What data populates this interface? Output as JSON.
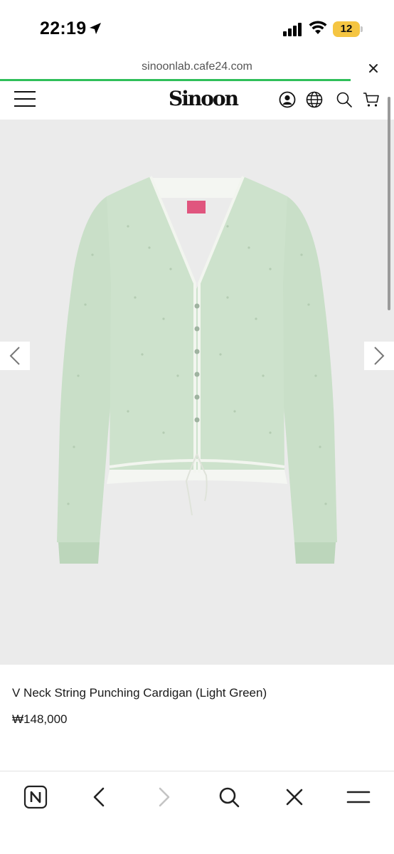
{
  "status_bar": {
    "time": "22:19",
    "battery": "12",
    "location_icon": "location-arrow-icon",
    "signal_icon": "cellular-signal-icon",
    "wifi_icon": "wifi-icon"
  },
  "browser": {
    "url": "sinoonlab.cafe24.com",
    "close_icon": "close-icon",
    "load_progress": 0.89
  },
  "site_header": {
    "logo": "Sinoon",
    "menu_icon": "hamburger-menu-icon",
    "account_icon": "user-account-icon",
    "language_icon": "globe-icon",
    "search_icon": "search-icon",
    "cart_icon": "shopping-cart-icon"
  },
  "product": {
    "image_alt": "cardigan-product-photo",
    "title": "V Neck String Punching Cardigan (Light Green)",
    "price": "₩148,000"
  },
  "bottom_toolbar": {
    "items": [
      "naver-home-icon",
      "back-arrow-icon",
      "forward-arrow-icon",
      "search-icon",
      "close-icon",
      "menu-icon"
    ]
  },
  "colors": {
    "cardigan_green": "#c9dfc8",
    "image_bg": "#ebebeb",
    "progress": "#2fbf5a",
    "label_pink": "#e0557e"
  }
}
